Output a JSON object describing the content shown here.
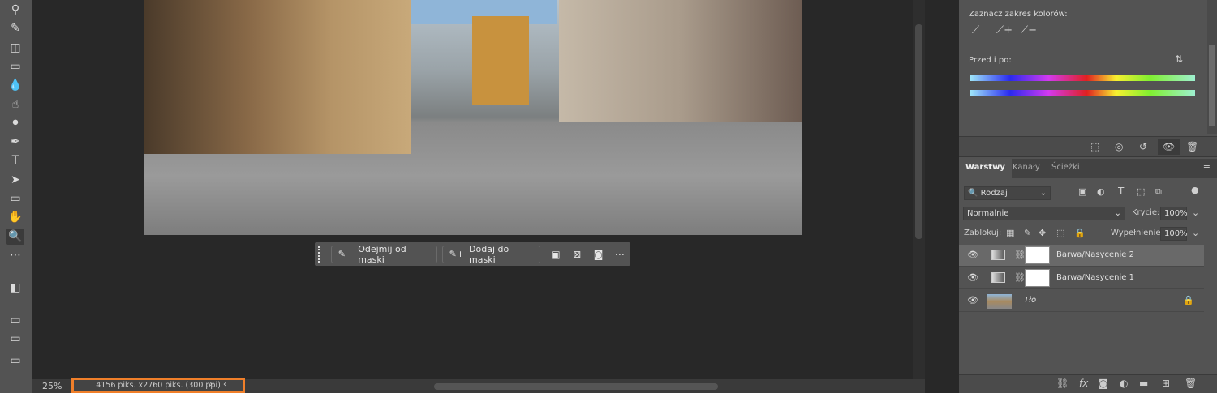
{
  "toolbar": {
    "tools": [
      {
        "name": "clone-stamp-tool",
        "glyph": "⚲"
      },
      {
        "name": "history-brush-tool",
        "glyph": "✎"
      },
      {
        "name": "eraser-tool",
        "glyph": "◫"
      },
      {
        "name": "gradient-tool",
        "glyph": "▭"
      },
      {
        "name": "blur-tool",
        "glyph": "💧"
      },
      {
        "name": "smudge-tool",
        "glyph": "☝"
      },
      {
        "name": "dodge-tool",
        "glyph": "⚫"
      },
      {
        "name": "pen-tool",
        "glyph": "✒"
      },
      {
        "name": "type-tool",
        "glyph": "T"
      },
      {
        "name": "path-selection-tool",
        "glyph": "➤"
      },
      {
        "name": "rectangle-tool",
        "glyph": "▭"
      },
      {
        "name": "hand-tool",
        "glyph": "✋"
      },
      {
        "name": "zoom-tool",
        "glyph": "🔍"
      },
      {
        "name": "more-tools",
        "glyph": "⋯"
      }
    ]
  },
  "contextbar": {
    "subtract": "Odejmij od maski",
    "add": "Dodaj do maski",
    "more": "⋯"
  },
  "status": {
    "zoom": "25%",
    "docinfo": "4156 piks. x2760 piks. (300 ppi)"
  },
  "properties": {
    "select_range": "Zaznacz zakres kolorów:",
    "before_after": "Przed i po:"
  },
  "layers_panel": {
    "tabs": [
      "Warstwy",
      "Kanały",
      "Ścieżki"
    ],
    "filter": "Rodzaj",
    "blend": "Normalnie",
    "opacity_label": "Krycie:",
    "opacity": "100%",
    "lock_label": "Zablokuj:",
    "fill_label": "Wypełnienie:",
    "fill": "100%",
    "layers": [
      {
        "name": "Barwa/Nasycenie 2",
        "type": "adjustment",
        "selected": true
      },
      {
        "name": "Barwa/Nasycenie 1",
        "type": "adjustment",
        "selected": false
      },
      {
        "name": "Tło",
        "type": "background",
        "selected": false
      }
    ]
  }
}
